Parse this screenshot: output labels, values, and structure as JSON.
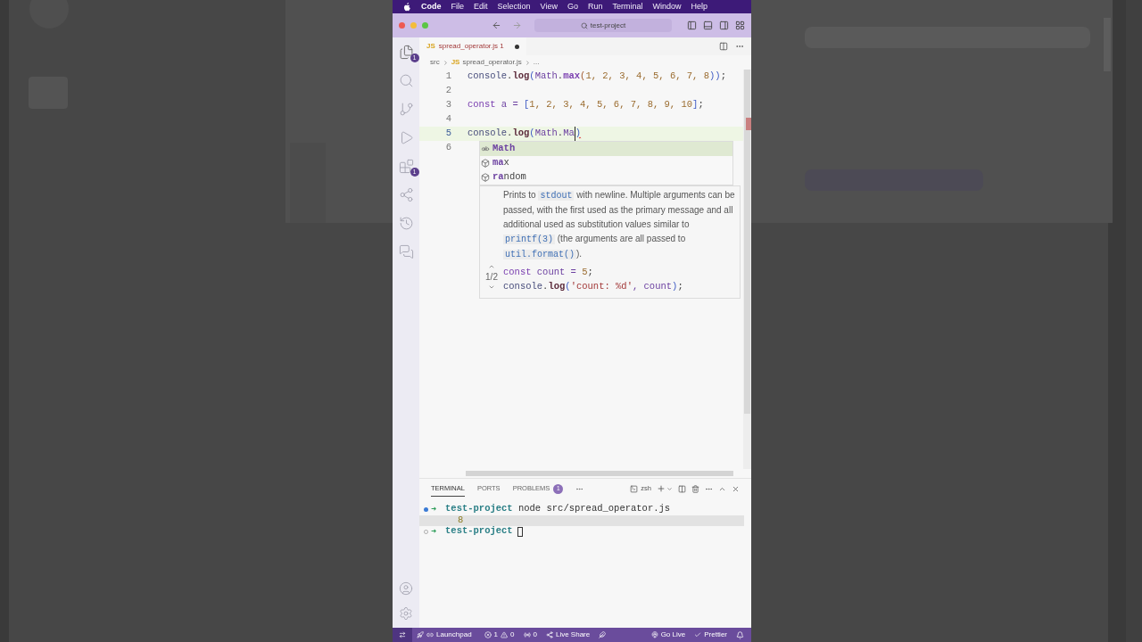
{
  "menubar": {
    "items": [
      {
        "label": "Code",
        "selected": true
      },
      {
        "label": "File",
        "selected": false
      },
      {
        "label": "Edit",
        "selected": false
      },
      {
        "label": "Selection",
        "selected": false
      },
      {
        "label": "View",
        "selected": false
      },
      {
        "label": "Go",
        "selected": false
      },
      {
        "label": "Run",
        "selected": false
      },
      {
        "label": "Terminal",
        "selected": false
      },
      {
        "label": "Window",
        "selected": false
      },
      {
        "label": "Help",
        "selected": false
      }
    ]
  },
  "titlebar": {
    "search": "test-project"
  },
  "activity_bar": {
    "items": [
      {
        "kind": "files",
        "badge": "1",
        "selected": true
      },
      {
        "kind": "search",
        "selected": false
      },
      {
        "kind": "git",
        "selected": false
      },
      {
        "kind": "run",
        "selected": false
      },
      {
        "kind": "extensions",
        "badge": "1",
        "selected": false
      },
      {
        "kind": "share",
        "selected": false
      },
      {
        "kind": "history",
        "selected": false
      },
      {
        "kind": "comments",
        "selected": false
      }
    ],
    "bottom": [
      {
        "kind": "account"
      },
      {
        "kind": "settings"
      }
    ]
  },
  "editor": {
    "tab": {
      "icon": "JS",
      "label": "spread_operator.js",
      "problems": "1",
      "modified": true
    },
    "breadcrumb": [
      {
        "label": "src"
      },
      {
        "icon": "JS",
        "label": "spread_operator.js"
      },
      {
        "label": "..."
      }
    ],
    "lines": [
      {
        "number": "1",
        "selected": false,
        "tokens": [
          {
            "text": "console",
            "kind": "obj"
          },
          {
            "text": ".",
            "kind": "punct"
          },
          {
            "text": "log",
            "kind": "fn"
          },
          {
            "text": "(",
            "kind": "bracket"
          },
          {
            "text": "Math",
            "kind": "type"
          },
          {
            "text": ".",
            "kind": "punct"
          },
          {
            "text": "max",
            "kind": "fn2"
          },
          {
            "text": "(",
            "kind": "bracket2"
          },
          {
            "text": "1, 2, 3, 4, 5, 6, 7, 8",
            "kind": "num"
          },
          {
            "text": "))",
            "kind": "bracket"
          },
          {
            "text": ";",
            "kind": "punct"
          }
        ]
      },
      {
        "number": "2",
        "selected": false
      },
      {
        "number": "3",
        "selected": false,
        "tokens": [
          {
            "text": "const",
            "kind": "kw"
          },
          {
            "text": " a = ",
            "kind": "type"
          },
          {
            "text": "[",
            "kind": "bracket"
          },
          {
            "text": "1, 2, 3, 4, 5, 6, 7, 8, 9, 10",
            "kind": "num"
          },
          {
            "text": "]",
            "kind": "bracket"
          },
          {
            "text": ";",
            "kind": "punct"
          }
        ]
      },
      {
        "number": "4",
        "selected": false
      },
      {
        "number": "5",
        "selected": true,
        "tokens": [
          {
            "text": "console",
            "kind": "obj"
          },
          {
            "text": ".",
            "kind": "punct"
          },
          {
            "text": "log",
            "kind": "fn"
          },
          {
            "text": "(",
            "kind": "bracket"
          },
          {
            "text": "Math",
            "kind": "type"
          },
          {
            "text": ".",
            "kind": "punct"
          },
          {
            "text": "Ma",
            "kind": "type",
            "cursor": true
          },
          {
            "text": ")",
            "kind": "bracket",
            "error": true
          }
        ]
      },
      {
        "number": "6",
        "selected": false
      }
    ],
    "suggest": {
      "items": [
        {
          "kind": "text",
          "match": "Math",
          "selected": true
        },
        {
          "kind": "property",
          "match": "ma",
          "rest": "x",
          "selected": false
        },
        {
          "kind": "property",
          "match": "ra",
          "rest": "ndom",
          "selected": false
        }
      ]
    },
    "hover": {
      "paragraph": [
        {
          "text": "Prints to "
        },
        {
          "text": "stdout",
          "code": true
        },
        {
          "text": " with newline. Multiple arguments can be passed, with the first used as the primary message and all additional used as substitution values similar to "
        },
        {
          "text": "printf(3)",
          "code": true
        },
        {
          "text": " (the arguments are all passed to "
        },
        {
          "text": "util.format()",
          "code": true
        },
        {
          "text": ")."
        }
      ],
      "counter": "1/2",
      "example": [
        [
          {
            "text": "const",
            "kind": "kw"
          },
          {
            "text": " count = ",
            "kind": "type"
          },
          {
            "text": "5",
            "kind": "num"
          },
          {
            "text": ";",
            "kind": "punct"
          }
        ],
        [
          {
            "text": "console",
            "kind": "obj"
          },
          {
            "text": ".",
            "kind": "punct"
          },
          {
            "text": "log",
            "kind": "fn"
          },
          {
            "text": "(",
            "kind": "bracket"
          },
          {
            "text": "'count: %d'",
            "kind": "str"
          },
          {
            "text": ", count",
            "kind": "type"
          },
          {
            "text": ")",
            "kind": "bracket"
          },
          {
            "text": ";",
            "kind": "punct"
          }
        ]
      ]
    }
  },
  "panel": {
    "tabs": [
      {
        "label": "TERMINAL",
        "selected": true
      },
      {
        "label": "PORTS",
        "selected": false
      },
      {
        "label": "PROBLEMS",
        "badge": "1",
        "selected": false
      }
    ],
    "shell": "zsh",
    "lines": [
      {
        "kind": "prompt",
        "finished": true,
        "arrow": "➜",
        "dir": "test-project",
        "command": "node src/spread_operator.js"
      },
      {
        "kind": "output",
        "text": "8",
        "selected": true
      },
      {
        "kind": "prompt",
        "finished": false,
        "arrow": "➜",
        "dir": "test-project",
        "cursor": true
      }
    ]
  },
  "status_bar": {
    "items": [
      {
        "kind": "remote"
      },
      {
        "kind": "launchpad",
        "text": "Launchpad"
      },
      {
        "kind": "problems",
        "errors": "1",
        "warnings": "0"
      },
      {
        "kind": "ports",
        "text": "0"
      },
      {
        "kind": "liveshare",
        "text": "Live Share"
      },
      {
        "kind": "feather"
      },
      {
        "kind": "golive",
        "text": "Go Live"
      },
      {
        "kind": "prettier",
        "text": "Prettier"
      },
      {
        "kind": "bell"
      }
    ]
  }
}
